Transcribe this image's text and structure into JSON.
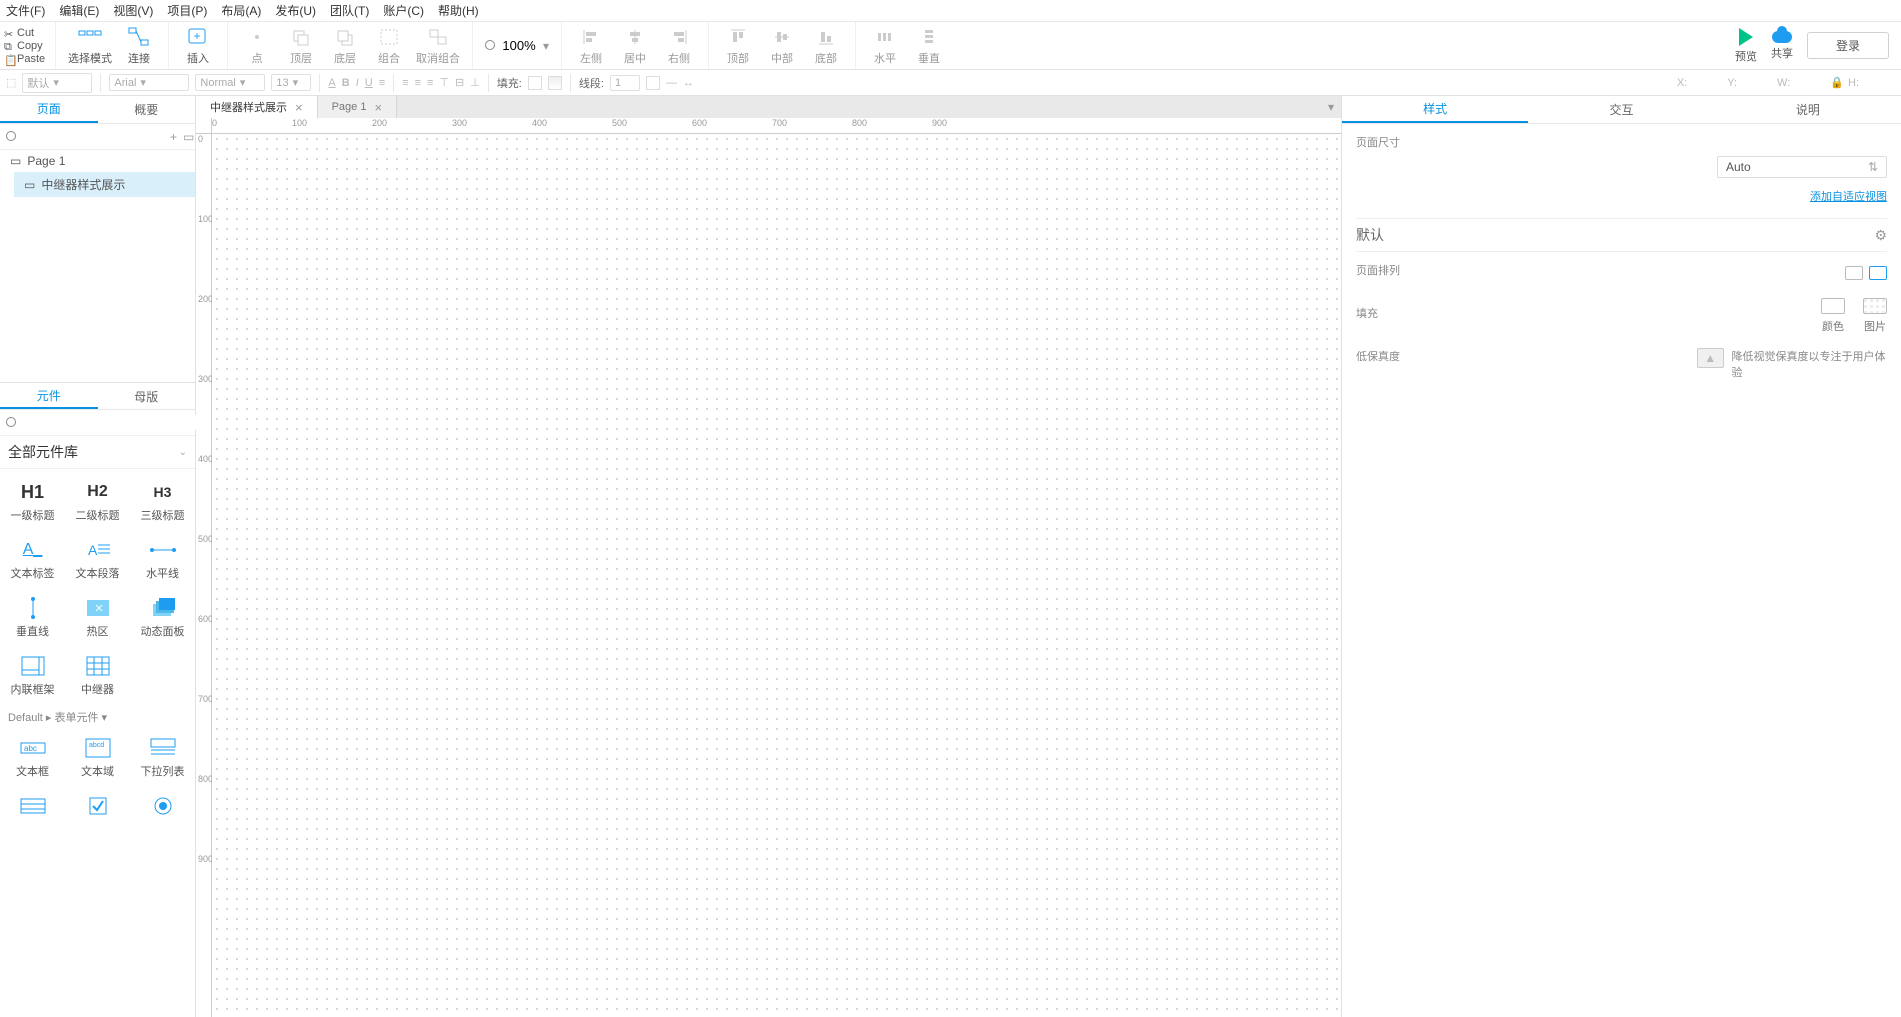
{
  "menu": [
    "文件(F)",
    "编辑(E)",
    "视图(V)",
    "项目(P)",
    "布局(A)",
    "发布(U)",
    "团队(T)",
    "账户(C)",
    "帮助(H)"
  ],
  "clipboard": {
    "cut": "Cut",
    "copy": "Copy",
    "paste": "Paste"
  },
  "toolbar": {
    "select_mode": "选择模式",
    "connect": "连接",
    "insert": "插入",
    "point": "点",
    "top": "顶层",
    "bottom": "底层",
    "group": "组合",
    "ungroup": "取消组合",
    "zoom": "100%",
    "align_left": "左侧",
    "align_center": "居中",
    "align_right": "右侧",
    "align_top": "顶部",
    "align_middle": "中部",
    "align_bottom": "底部",
    "dist_h": "水平",
    "dist_v": "垂直"
  },
  "right_actions": {
    "preview": "预览",
    "share": "共享",
    "login": "登录"
  },
  "stylebar": {
    "default": "默认",
    "font": "Arial",
    "weight": "Normal",
    "size": "13",
    "fill": "填充:",
    "line": "线段:",
    "line_w": "1",
    "x": "X:",
    "y": "Y:",
    "w": "W:",
    "h": "H:"
  },
  "left_tabs": {
    "pages": "页面",
    "outline": "概要"
  },
  "pages": [
    {
      "name": "Page 1",
      "selected": false,
      "indent": false
    },
    {
      "name": "中继器样式展示",
      "selected": true,
      "indent": true
    }
  ],
  "widget_tabs": {
    "widgets": "元件",
    "masters": "母版"
  },
  "widget_lib_title": "全部元件库",
  "widgets_basic": [
    {
      "big": "H1",
      "label": "一级标题"
    },
    {
      "big": "H2",
      "label": "二级标题"
    },
    {
      "big": "H3",
      "label": "三级标题"
    },
    {
      "ic": "textlabel",
      "label": "文本标签"
    },
    {
      "ic": "para",
      "label": "文本段落"
    },
    {
      "ic": "hline",
      "label": "水平线"
    },
    {
      "ic": "vline",
      "label": "垂直线"
    },
    {
      "ic": "hotspot",
      "label": "热区"
    },
    {
      "ic": "dynpanel",
      "label": "动态面板"
    },
    {
      "ic": "iframe",
      "label": "内联框架"
    },
    {
      "ic": "repeater",
      "label": "中继器"
    }
  ],
  "widget_sect": "Default ▸ 表单元件 ▾",
  "widgets_form": [
    {
      "ic": "textfield",
      "label": "文本框"
    },
    {
      "ic": "textarea",
      "label": "文本域"
    },
    {
      "ic": "droplist",
      "label": "下拉列表"
    },
    {
      "ic": "listbox",
      "label": ""
    },
    {
      "ic": "checkbox",
      "label": ""
    },
    {
      "ic": "radio",
      "label": ""
    }
  ],
  "canvas_tabs": [
    {
      "label": "中继器样式展示",
      "active": true
    },
    {
      "label": "Page 1",
      "active": false
    }
  ],
  "ruler_ticks": [
    "0",
    "100",
    "200",
    "300",
    "400",
    "500",
    "600",
    "700",
    "800",
    "900"
  ],
  "right_tabs": {
    "style": "样式",
    "interact": "交互",
    "notes": "说明"
  },
  "rpane": {
    "page_size": "页面尺寸",
    "auto": "Auto",
    "add_adaptive": "添加自适应视图",
    "default": "默认",
    "page_align": "页面排列",
    "fill": "填充",
    "fill_color": "颜色",
    "fill_image": "图片",
    "lofi": "低保真度",
    "lofi_desc": "降低视觉保真度以专注于用户体验"
  }
}
